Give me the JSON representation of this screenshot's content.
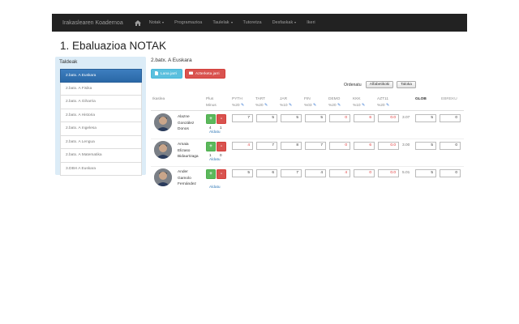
{
  "navbar": {
    "brand": "Irakaslearen Koadernoa",
    "items": [
      {
        "label": "Notak",
        "caret": true
      },
      {
        "label": "Programazioa",
        "caret": false
      },
      {
        "label": "Taulelak",
        "caret": true
      },
      {
        "label": "Tutoretza",
        "caret": false
      },
      {
        "label": "Desfaskak",
        "caret": true
      },
      {
        "label": "Ikeri",
        "caret": false
      }
    ]
  },
  "page_title": "1. Ebaluazioa NOTAK",
  "sidebar": {
    "title": "Taldeak",
    "groups": [
      "2.batx. A Euskara",
      "2.batx. A Fisika",
      "2.batx. A Giharria",
      "2.batx. A Historia",
      "2.batx. A Ingelesa",
      "2.batx. A Lengua",
      "2.batx. A Matematika",
      "3.DBH A Euskara"
    ]
  },
  "content": {
    "title": "2.batx. A Euskara",
    "btn_add": "Lana jarri",
    "btn_remove": "Azterketa jarri",
    "sort_label": "Ordenatu",
    "sort_alpha": "Alfabetikoki",
    "sort_table": "Taloka"
  },
  "table": {
    "headers": {
      "student": "Ikaslea",
      "plus": "Plus",
      "minus": "Minus",
      "cols": [
        {
          "name": "PYTH",
          "pct": "%20"
        },
        {
          "name": "TART",
          "pct": "%20"
        },
        {
          "name": "JAR",
          "pct": "%10"
        },
        {
          "name": "FIN",
          "pct": "%03"
        },
        {
          "name": "DEMO",
          "pct": "%20"
        },
        {
          "name": "KKK",
          "pct": "%10"
        },
        {
          "name": "AZT11",
          "pct": "%20"
        }
      ],
      "glob": "GLOB",
      "ebreku": "EBREKU"
    },
    "rows": [
      {
        "name1": "Alazne",
        "name2": "González",
        "name3": "Donos",
        "plus_count": "4",
        "minus_count": "1",
        "aldatu": "Aldatu",
        "cells": [
          "7",
          "5",
          "5",
          "5",
          "0",
          "6",
          "0.0"
        ],
        "red": [
          false,
          false,
          false,
          false,
          true,
          true,
          true
        ],
        "total": "3.07",
        "glob": "5",
        "ebreku": "0"
      },
      {
        "name1": "Amaia",
        "name2": "Elizaso",
        "name3": "Bidaurtzaga",
        "plus_count": "1",
        "minus_count": "0",
        "aldatu": "Aldatu",
        "cells": [
          "4",
          "7",
          "8",
          "7",
          "0",
          "6",
          "0.0"
        ],
        "red": [
          true,
          false,
          false,
          false,
          true,
          true,
          true
        ],
        "total": "3.00",
        "glob": "5",
        "ebreku": "0"
      },
      {
        "name1": "Ander",
        "name2": "Gamolo",
        "name3": "Fernández",
        "plus_count": "",
        "minus_count": "",
        "aldatu": "Aldatu",
        "cells": [
          "5",
          "6",
          "7",
          "4",
          "4",
          "0",
          "0.0"
        ],
        "red": [
          false,
          false,
          false,
          false,
          true,
          true,
          true
        ],
        "total": "5.01",
        "glob": "5",
        "ebreku": "0"
      }
    ]
  },
  "colors": {
    "navbar": "#222222",
    "sidebar_bg": "#dcecf7",
    "active_group": "#2e6da4",
    "btn_info": "#5bc0de",
    "btn_danger": "#d9534f",
    "plus": "#5cb85c",
    "link": "#337ab7",
    "red_value": "#e03030"
  },
  "icons": {
    "home": "home-icon",
    "file": "file-icon",
    "clipboard": "clipboard-icon",
    "pencil": "pencil-icon"
  }
}
